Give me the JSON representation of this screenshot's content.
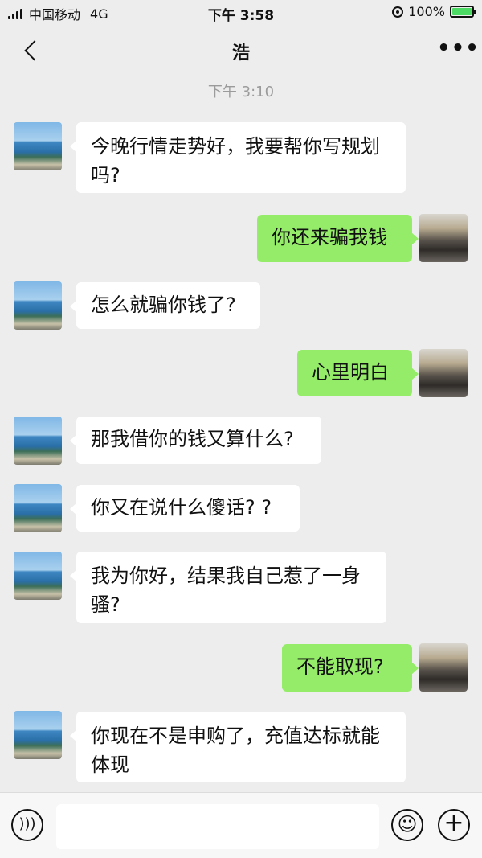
{
  "status_bar": {
    "carrier": "中国移动",
    "network": "4G",
    "time": "下午 3:58",
    "battery": "100%",
    "battery_level": 1.0
  },
  "nav": {
    "title": "浩",
    "more_label": "•••",
    "back_icon": "chevron-left-icon"
  },
  "timestamp": "下午 3:10",
  "messages": [
    {
      "side": "left",
      "text_lines": [
        "今晚行情走势好，我要帮你写规划",
        "吗?"
      ]
    },
    {
      "side": "right",
      "text_lines": [
        "你还来骗我钱"
      ]
    },
    {
      "side": "left",
      "text_lines": [
        "怎么就骗你钱了?"
      ]
    },
    {
      "side": "right",
      "text_lines": [
        "心里明白"
      ]
    },
    {
      "side": "left",
      "text_lines": [
        "那我借你的钱又算什么?"
      ]
    },
    {
      "side": "left",
      "text_lines": [
        "你又在说什么傻话? ?"
      ]
    },
    {
      "side": "left",
      "text_lines": [
        "我为你好，结果我自己惹了一身",
        "骚?"
      ]
    },
    {
      "side": "right",
      "text_lines": [
        "不能取现?"
      ]
    },
    {
      "side": "left",
      "text_lines": [
        "你现在不是申购了，充值达标就能",
        "体现"
      ]
    }
  ],
  "input_bar": {
    "placeholder": "",
    "voice_icon": "voice-icon",
    "emoji_icon": "emoji-icon",
    "plus_icon": "plus-icon"
  },
  "colors": {
    "background": "#ededed",
    "sent_bubble": "#95ec69",
    "received_bubble": "#ffffff"
  }
}
